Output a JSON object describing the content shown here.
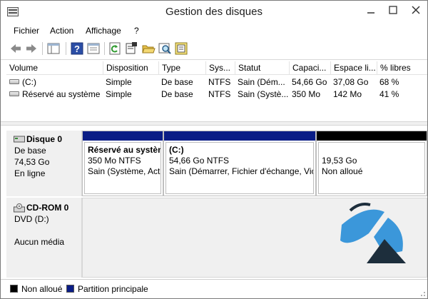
{
  "window": {
    "title": "Gestion des disques",
    "controls": [
      "minimize",
      "maximize",
      "close"
    ]
  },
  "menu": [
    {
      "label": "Fichier"
    },
    {
      "label": "Action"
    },
    {
      "label": "Affichage"
    },
    {
      "label": "?"
    }
  ],
  "toolbar": {
    "buttons": [
      "back-arrow-icon",
      "forward-arrow-icon",
      "console-tree-icon",
      "help-icon",
      "properties-pane-icon",
      "refresh-icon",
      "properties-icon",
      "open-folder-icon",
      "explore-icon",
      "rescan-icon"
    ]
  },
  "volume_list": {
    "columns": [
      "Volume",
      "Disposition",
      "Type",
      "Sys...",
      "Statut",
      "Capaci...",
      "Espace li...",
      "% libres"
    ],
    "rows": [
      {
        "volume": "(C:)",
        "disposition": "Simple",
        "type": "De base",
        "fs": "NTFS",
        "status": "Sain (Dém...",
        "capacity": "54,66 Go",
        "free": "37,08 Go",
        "pct": "68 %"
      },
      {
        "volume": "Réservé au système",
        "disposition": "Simple",
        "type": "De base",
        "fs": "NTFS",
        "status": "Sain (Systè...",
        "capacity": "350 Mo",
        "free": "142 Mo",
        "pct": "41 %"
      }
    ]
  },
  "disks": [
    {
      "name": "Disque 0",
      "kind": "De base",
      "size": "74,53 Go",
      "state": "En ligne",
      "partitions": [
        {
          "title": "Réservé au systèm",
          "size": "350 Mo NTFS",
          "status": "Sain (Système, Acti",
          "bar": "primary"
        },
        {
          "title": "(C:)",
          "size": "54,66 Go NTFS",
          "status": "Sain (Démarrer, Fichier d'échange, Vic",
          "bar": "primary"
        },
        {
          "title": "",
          "size": "19,53 Go",
          "status": "Non alloué",
          "bar": "unallocated"
        }
      ]
    },
    {
      "name": "CD-ROM 0",
      "kind": "DVD (D:)",
      "media": "Aucun média"
    }
  ],
  "legend": [
    {
      "label": "Non alloué",
      "color": "#000000"
    },
    {
      "label": "Partition principale",
      "color": "#0a1d86"
    }
  ],
  "colors": {
    "primary_bar": "#0a1d86",
    "unallocated_bar": "#000000",
    "label_panel": "#f0f0f0",
    "watermark_blue": "#2b8fd8",
    "watermark_dark": "#1d2e3c"
  }
}
